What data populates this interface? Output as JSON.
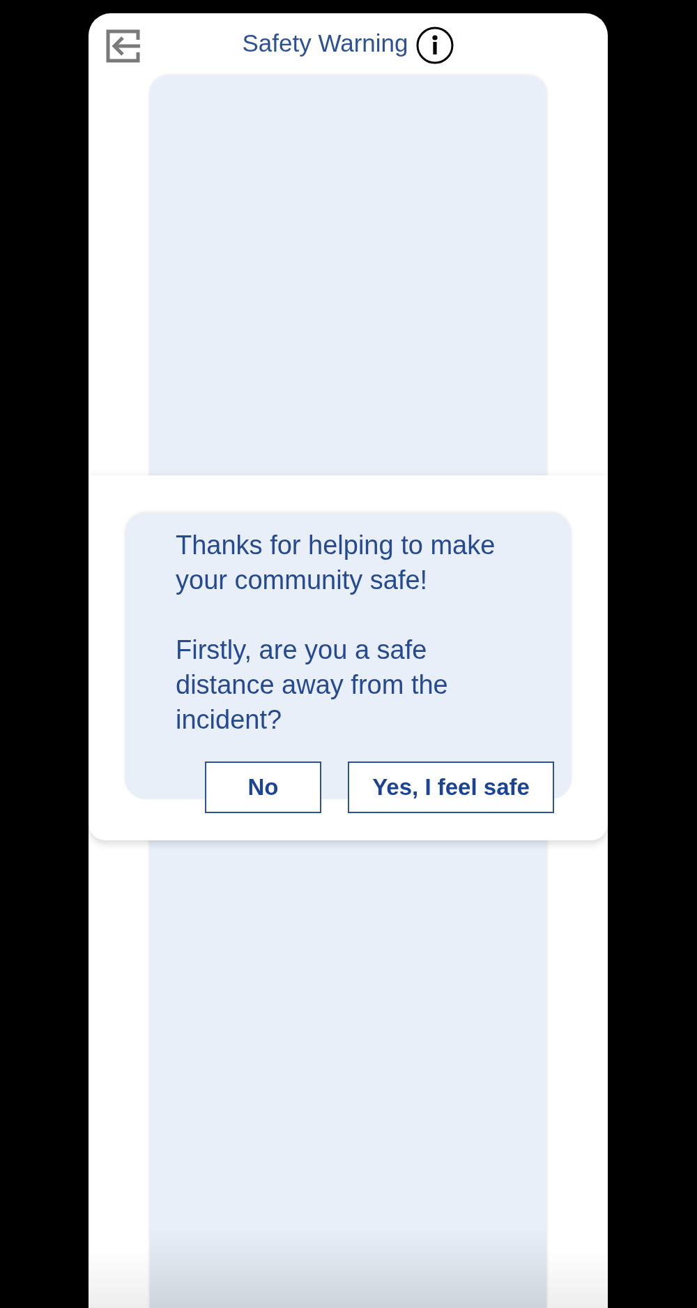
{
  "header": {
    "title": "Safety Warning"
  },
  "dialog": {
    "paragraphs": [
      [
        "Thanks for helping to make",
        "your community safe!"
      ],
      [
        "Firstly, are you a safe",
        "distance away from the",
        "incident?"
      ]
    ],
    "buttons": [
      {
        "label": "No",
        "kind": "secondary"
      },
      {
        "label": "Yes, I feel safe",
        "kind": "primary"
      }
    ]
  }
}
